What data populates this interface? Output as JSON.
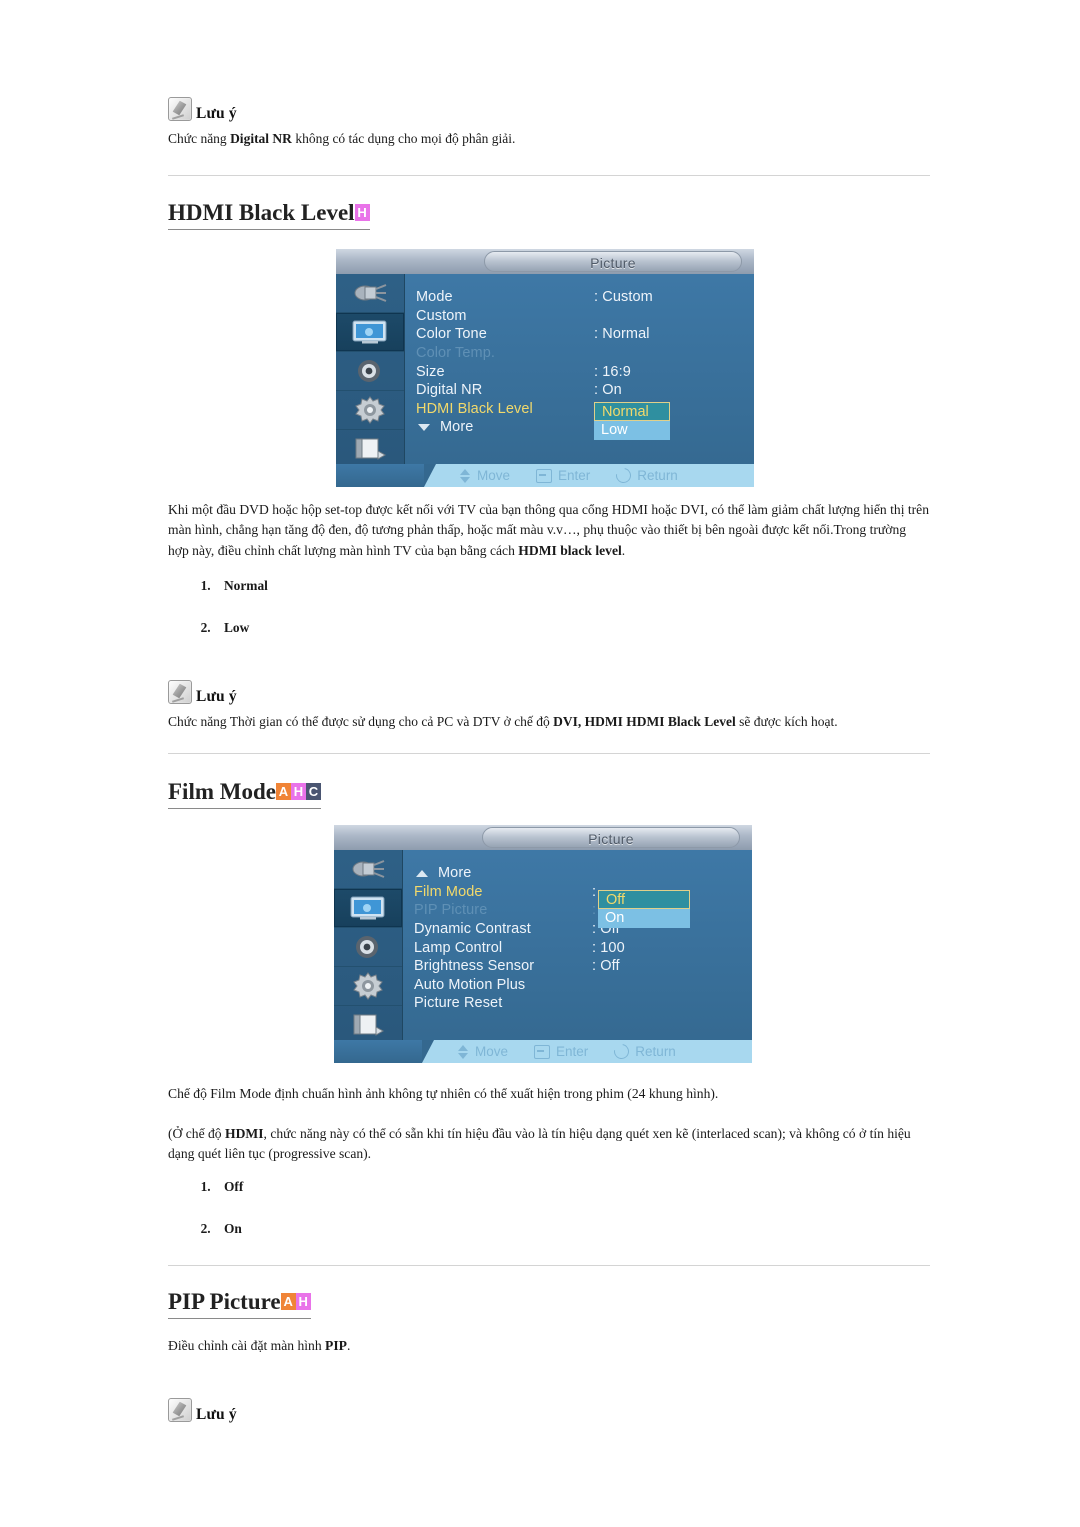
{
  "notes": {
    "label": "Lưu ý",
    "note1_body_pre": "Chức năng ",
    "note1_body_bold": "Digital NR",
    "note1_body_post": " không có tác dụng cho mọi độ phân giải.",
    "note2_body_pre": "Chức năng Thời gian có thể được sử dụng cho cả PC và DTV ở chế độ ",
    "note2_body_bold": "DVI, HDMI HDMI Black Level",
    "note2_body_post": " sẽ được kích hoạt."
  },
  "sections": {
    "hdmi_black_level": {
      "title": "HDMI Black Level",
      "badges": [
        {
          "letter": "H",
          "color": "#e973e9"
        }
      ],
      "paragraph_pre": "Khi một đầu DVD hoặc hộp set-top được kết nối với TV của bạn thông qua cổng HDMI hoặc DVI, có thể làm giảm chất lượng hiển thị trên màn hình, chẳng hạn tăng độ đen, độ tương phản thấp, hoặc mất màu v.v…, phụ thuộc vào thiết bị bên ngoài được kết nối.Trong trường hợp này, điều chỉnh chất lượng màn hình TV của bạn bằng cách ",
      "paragraph_bold": "HDMI black level",
      "paragraph_post": ".",
      "options": [
        "Normal",
        "Low"
      ]
    },
    "film_mode": {
      "title": "Film Mode",
      "badges": [
        {
          "letter": "A",
          "color": "#f08437"
        },
        {
          "letter": "H",
          "color": "#e973e9"
        },
        {
          "letter": "C",
          "color": "#4a5571"
        }
      ],
      "paragraph1": "Chế độ Film Mode định chuẩn hình ảnh không tự nhiên có thể xuất hiện trong phim (24 khung hình).",
      "paragraph2_pre": "(Ở chế độ ",
      "paragraph2_bold": "HDMI",
      "paragraph2_post": ", chức năng này có thể có sẵn khi tín hiệu đầu vào là tín hiệu dạng quét xen kẽ (interlaced scan); và không có ở tín hiệu dạng quét liên tục (progressive scan).",
      "options": [
        "Off",
        "On"
      ]
    },
    "pip_picture": {
      "title": "PIP Picture",
      "badges": [
        {
          "letter": "A",
          "color": "#f08437"
        },
        {
          "letter": "H",
          "color": "#e973e9"
        }
      ],
      "paragraph_pre": "Điều chỉnh cài đặt màn hình ",
      "paragraph_bold": "PIP",
      "paragraph_post": "."
    }
  },
  "osd1": {
    "title": "Picture",
    "sidebar_icons": [
      "input-plug-icon",
      "picture-monitor-icon",
      "sound-speaker-icon",
      "setup-gear-icon",
      "multi-control-book-icon"
    ],
    "active_sidebar_index": 1,
    "rows": [
      {
        "label": "Mode",
        "value": ": Custom",
        "state": "normal"
      },
      {
        "label": "Custom",
        "value": "",
        "state": "normal"
      },
      {
        "label": "Color Tone",
        "value": ": Normal",
        "state": "normal"
      },
      {
        "label": "Color Temp.",
        "value": "",
        "state": "dim"
      },
      {
        "label": "Size",
        "value": ": 16:9",
        "state": "normal"
      },
      {
        "label": "Digital NR",
        "value": ": On",
        "state": "normal"
      },
      {
        "label": "HDMI Black Level",
        "value": ":",
        "state": "selected"
      },
      {
        "label": "More",
        "value": "",
        "state": "more-down"
      }
    ],
    "popup": {
      "selected": "Normal",
      "other": "Low"
    },
    "footer": {
      "move": "Move",
      "enter": "Enter",
      "return": "Return"
    }
  },
  "osd2": {
    "title": "Picture",
    "sidebar_icons": [
      "input-plug-icon",
      "picture-monitor-icon",
      "sound-speaker-icon",
      "setup-gear-icon",
      "multi-control-book-icon"
    ],
    "active_sidebar_index": 1,
    "rows": [
      {
        "label": "More",
        "value": "",
        "state": "more-up"
      },
      {
        "label": "Film Mode",
        "value": ":",
        "state": "selected"
      },
      {
        "label": "PIP Picture",
        "value": ":",
        "state": "dim"
      },
      {
        "label": "Dynamic Contrast",
        "value": ": Off",
        "state": "normal"
      },
      {
        "label": "Lamp Control",
        "value": ": 100",
        "state": "normal"
      },
      {
        "label": "Brightness Sensor",
        "value": ": Off",
        "state": "normal"
      },
      {
        "label": "Auto Motion Plus",
        "value": "",
        "state": "normal"
      },
      {
        "label": "Picture Reset",
        "value": "",
        "state": "normal"
      }
    ],
    "popup": {
      "selected": "Off",
      "other": "On"
    },
    "footer": {
      "move": "Move",
      "enter": "Enter",
      "return": "Return"
    }
  }
}
